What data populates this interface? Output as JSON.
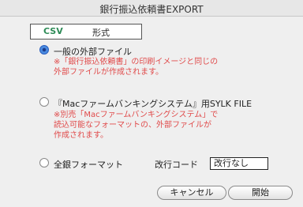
{
  "window": {
    "title": "銀行振込依頼書EXPORT"
  },
  "format": {
    "csv_label": "CSV",
    "format_label": "形式"
  },
  "options": [
    {
      "label": "一般の外部ファイル",
      "selected": true,
      "note": [
        "※「銀行振込依頼書」の印刷イメージと同じの",
        "外部ファイルが作成されます。"
      ]
    },
    {
      "label": "『Macファームバンキングシステム』用SYLK FILE",
      "selected": false,
      "note": [
        "※別売「Macファームバンキングシステム」で",
        "読込可能なフォーマットの、外部ファイルが",
        "作成されます。"
      ]
    },
    {
      "label": "全銀フォーマット",
      "selected": false,
      "note": []
    }
  ],
  "linefeed": {
    "label": "改行コード",
    "value": "改行なし"
  },
  "buttons": {
    "cancel": "キャンセル",
    "start": "開始"
  },
  "colors": {
    "note": "#e04a4a",
    "csv": "#2e8b57",
    "radio_selected": "#2a5fbf"
  }
}
